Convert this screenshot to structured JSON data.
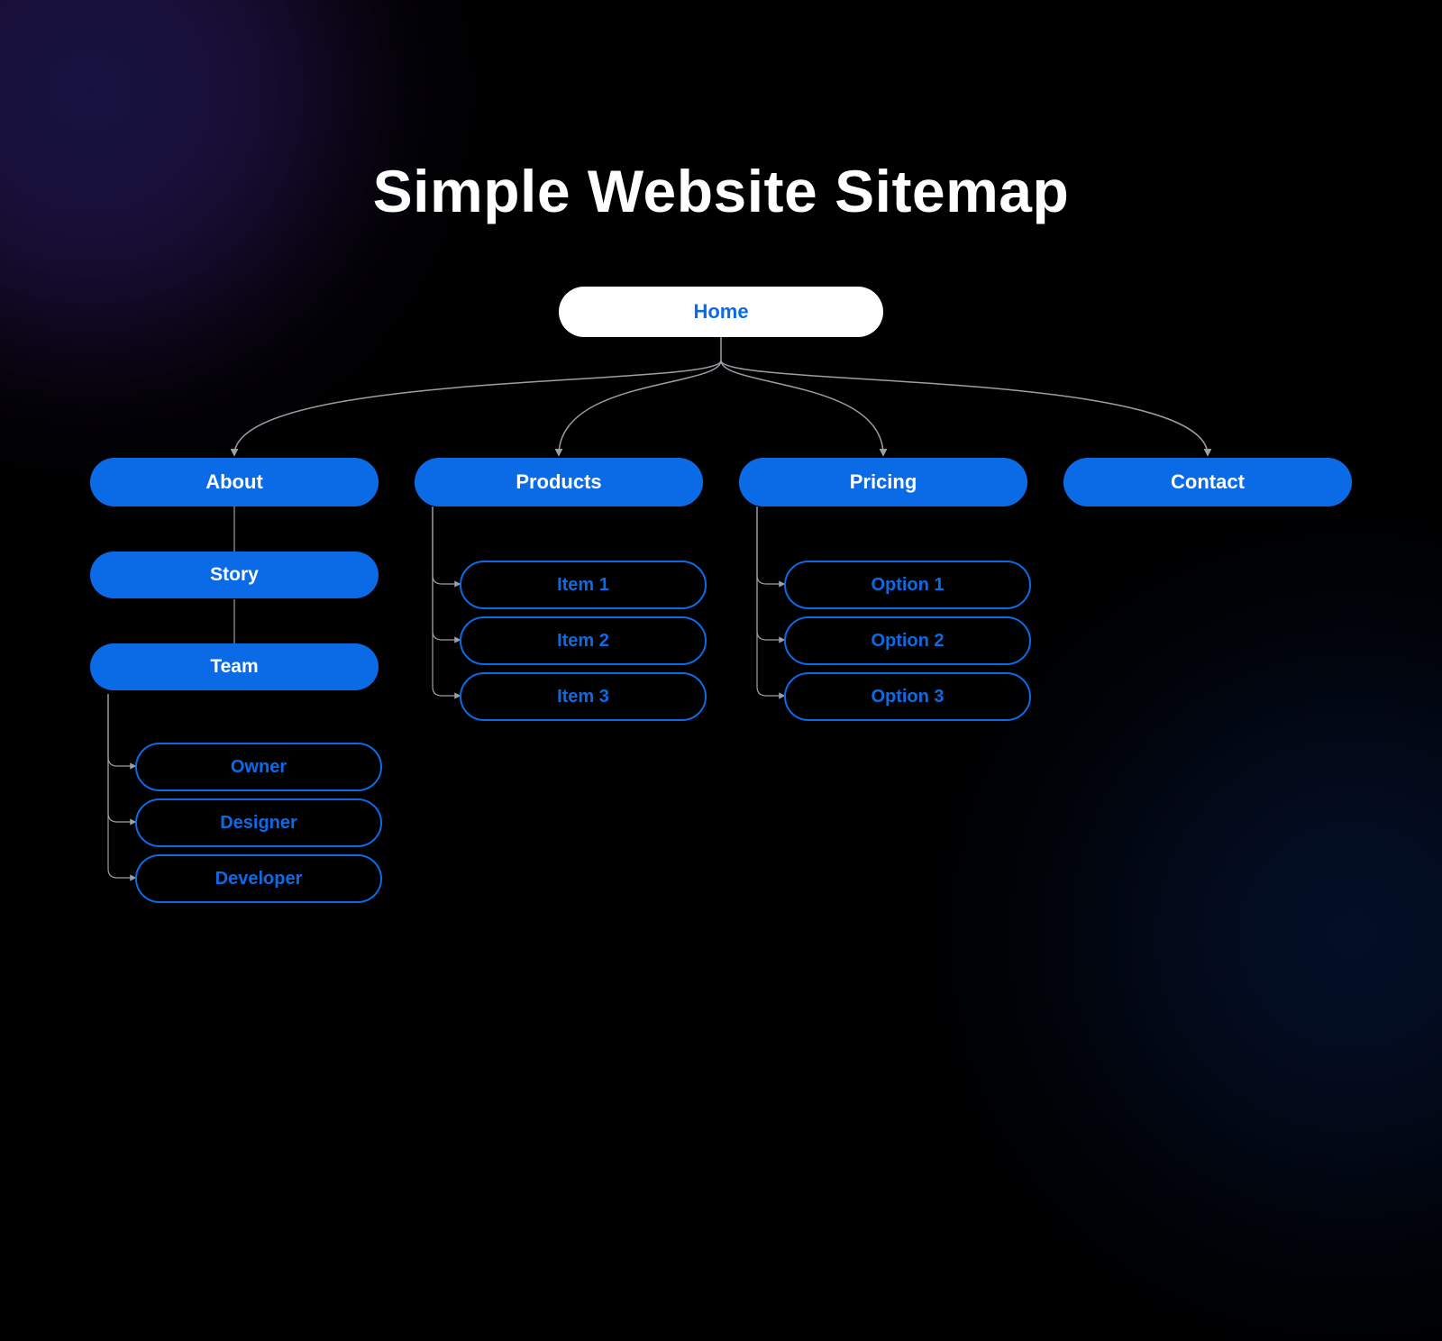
{
  "title": "Simple Website Sitemap",
  "root": {
    "label": "Home"
  },
  "sections": [
    {
      "label": "About",
      "children": [
        {
          "label": "Story"
        },
        {
          "label": "Team",
          "children": [
            {
              "label": "Owner"
            },
            {
              "label": "Designer"
            },
            {
              "label": "Developer"
            }
          ]
        }
      ]
    },
    {
      "label": "Products",
      "children": [
        {
          "label": "Item 1"
        },
        {
          "label": "Item 2"
        },
        {
          "label": "Item 3"
        }
      ]
    },
    {
      "label": "Pricing",
      "children": [
        {
          "label": "Option 1"
        },
        {
          "label": "Option 2"
        },
        {
          "label": "Option 3"
        }
      ]
    },
    {
      "label": "Contact"
    }
  ]
}
